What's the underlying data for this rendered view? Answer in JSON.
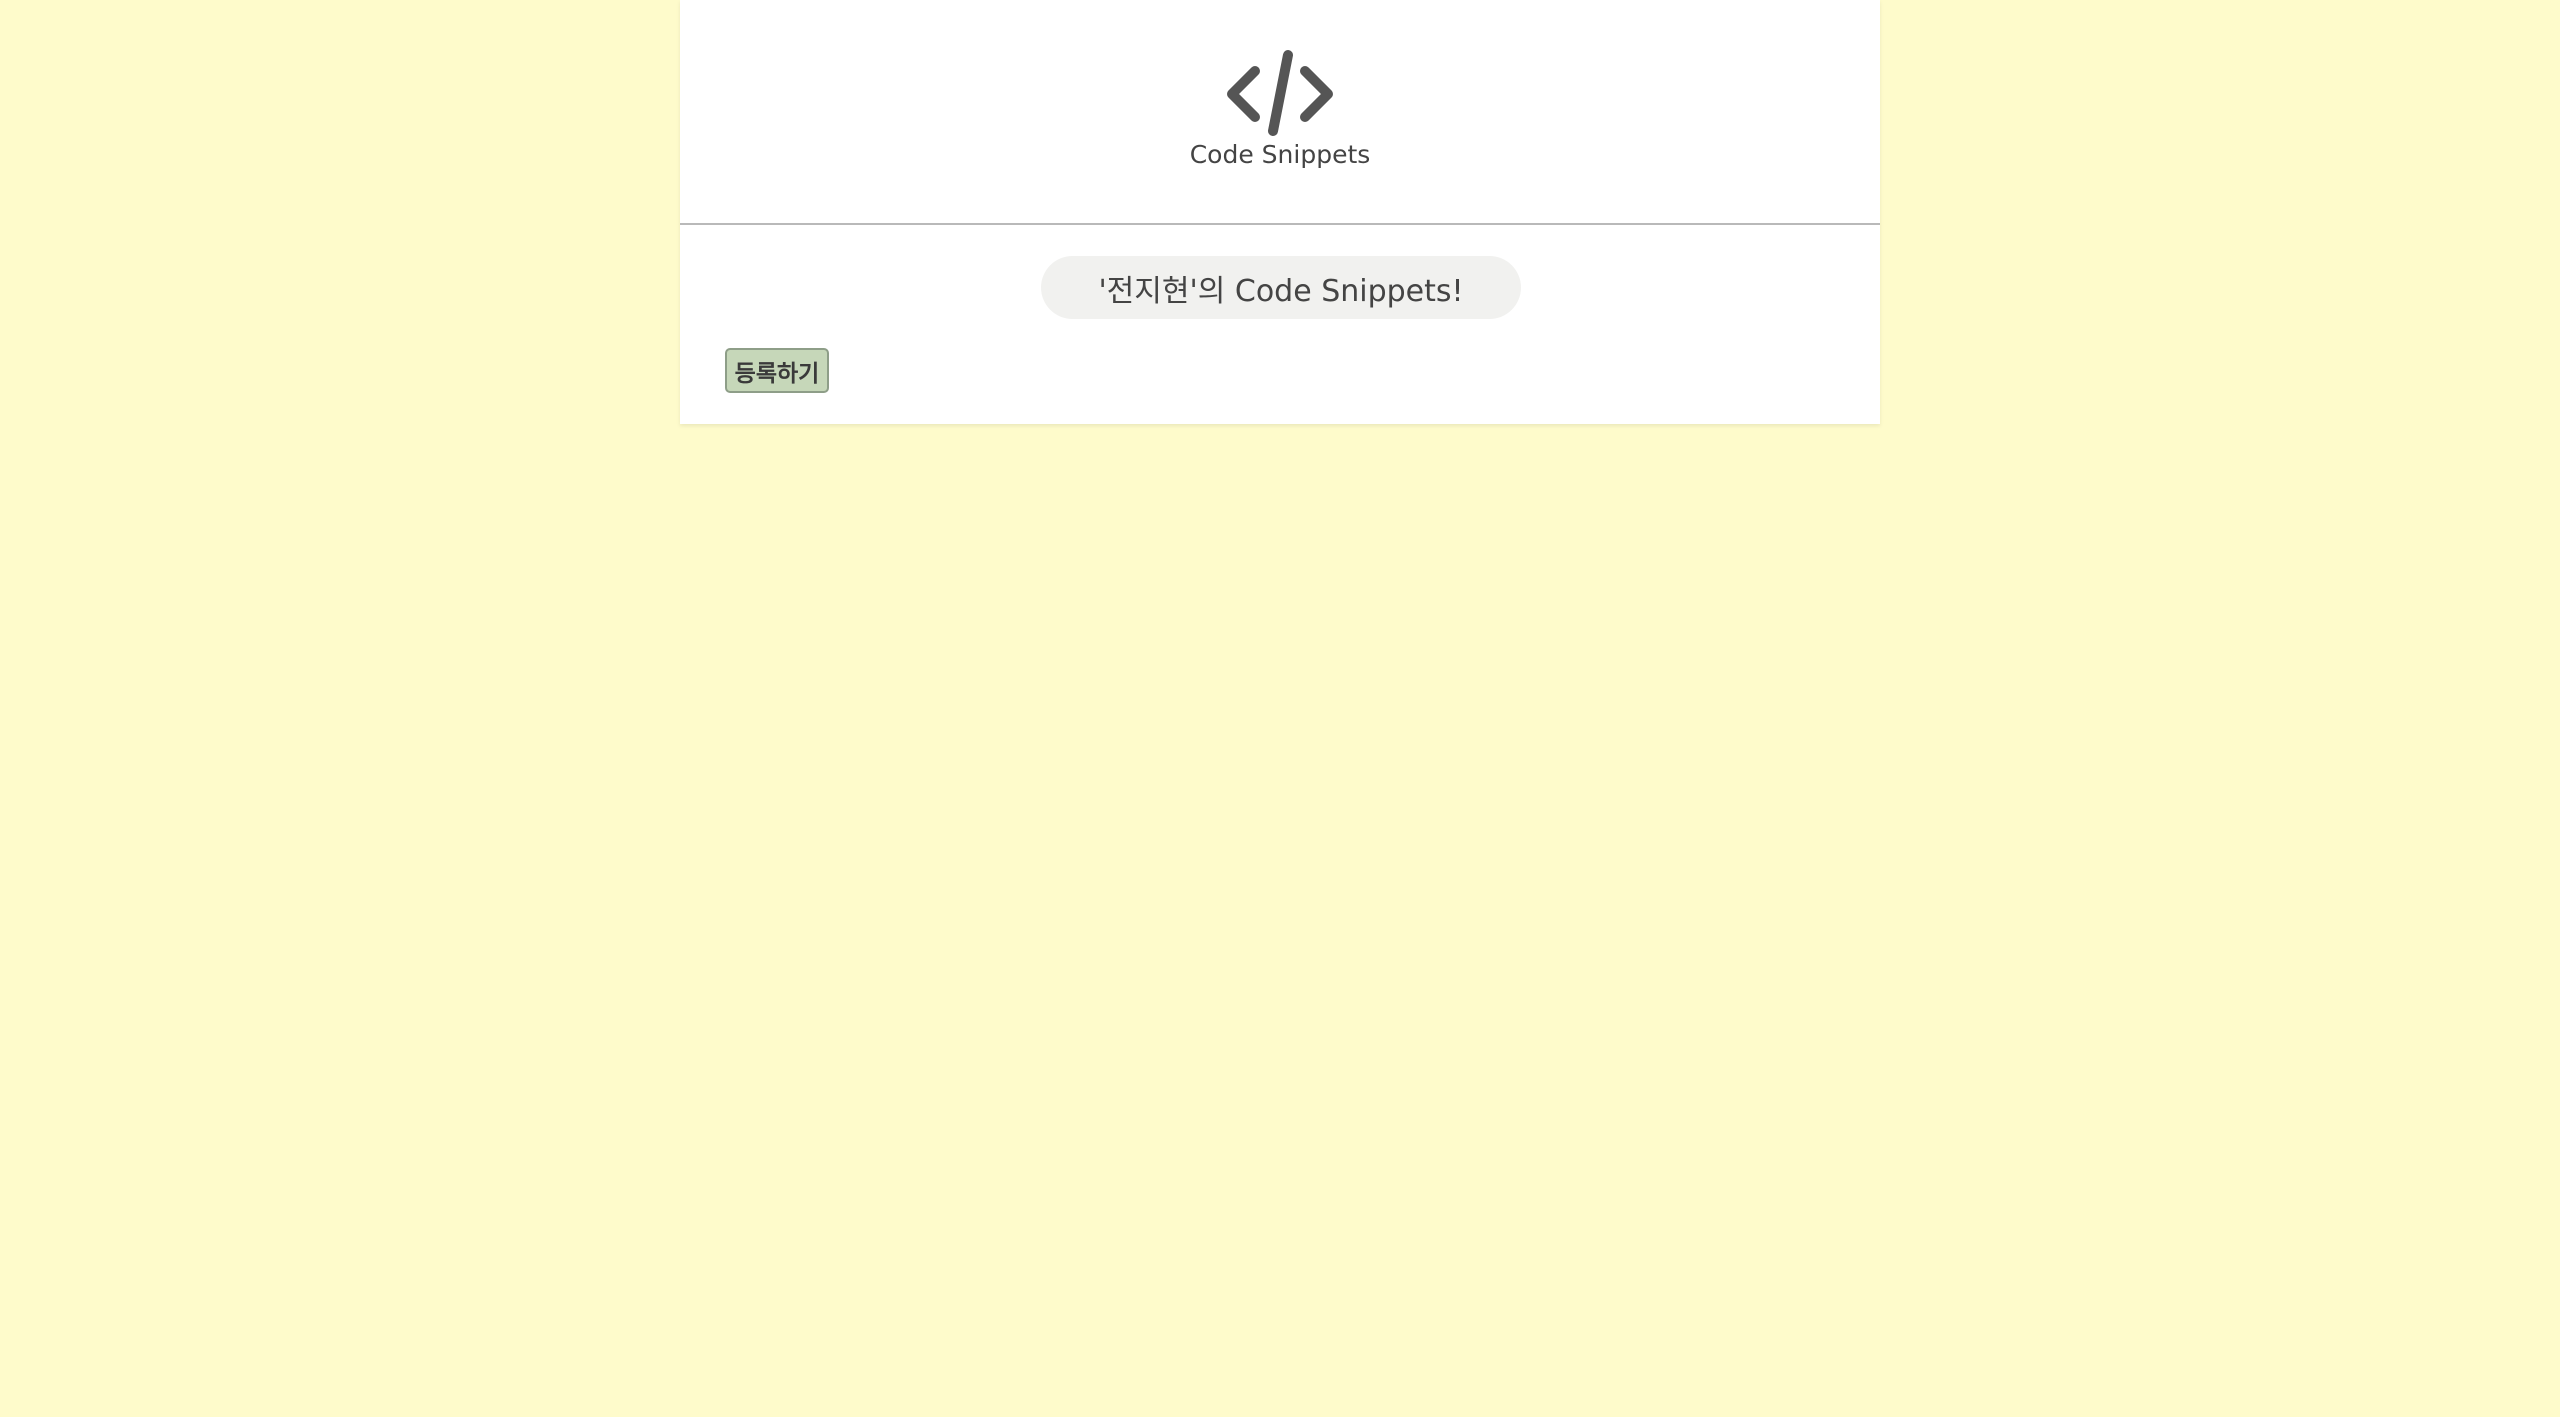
{
  "header": {
    "logo_icon": "code-icon",
    "logo_label": "Code Snippets"
  },
  "main": {
    "greeting": "'전지현'의 Code Snippets!",
    "register_label": "등록하기"
  },
  "colors": {
    "page_background": "#fefbcb",
    "card_background": "#ffffff",
    "greeting_background": "#f1f1ef",
    "button_background": "#c6d7b9",
    "icon_color": "#555555"
  }
}
